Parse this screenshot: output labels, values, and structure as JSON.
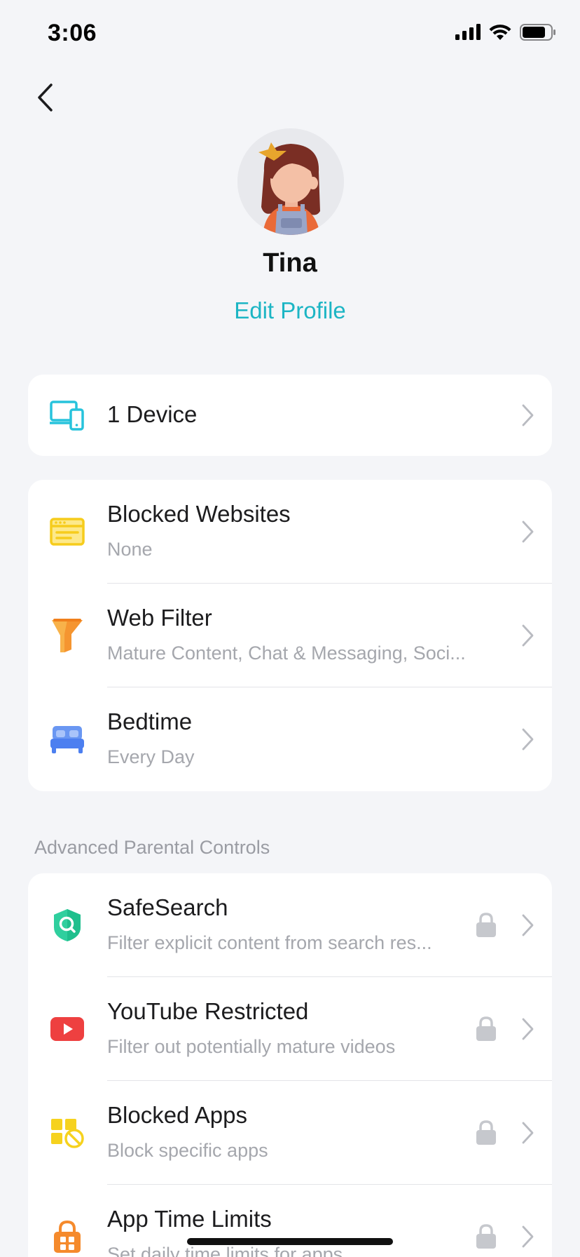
{
  "status_bar": {
    "time": "3:06"
  },
  "profile": {
    "name": "Tina",
    "edit_label": "Edit Profile"
  },
  "devices": {
    "label": "1 Device"
  },
  "controls": [
    {
      "title": "Blocked Websites",
      "subtitle": "None",
      "icon": "browser-window-icon"
    },
    {
      "title": "Web Filter",
      "subtitle": "Mature Content, Chat & Messaging, Soci...",
      "icon": "funnel-icon"
    },
    {
      "title": "Bedtime",
      "subtitle": "Every Day",
      "icon": "bed-icon"
    }
  ],
  "advanced": {
    "section_title": "Advanced Parental Controls",
    "items": [
      {
        "title": "SafeSearch",
        "subtitle": "Filter explicit content from search res...",
        "icon": "shield-search-icon"
      },
      {
        "title": "YouTube Restricted",
        "subtitle": "Filter out potentially mature videos",
        "icon": "youtube-icon"
      },
      {
        "title": "Blocked Apps",
        "subtitle": "Block specific apps",
        "icon": "blocked-apps-icon"
      },
      {
        "title": "App Time Limits",
        "subtitle": "Set daily time limits for apps",
        "icon": "lock-grid-icon"
      }
    ]
  },
  "colors": {
    "accent": "#1cb5c4",
    "background": "#f4f5f8",
    "card": "#ffffff",
    "muted_text": "#a5a7ad"
  }
}
